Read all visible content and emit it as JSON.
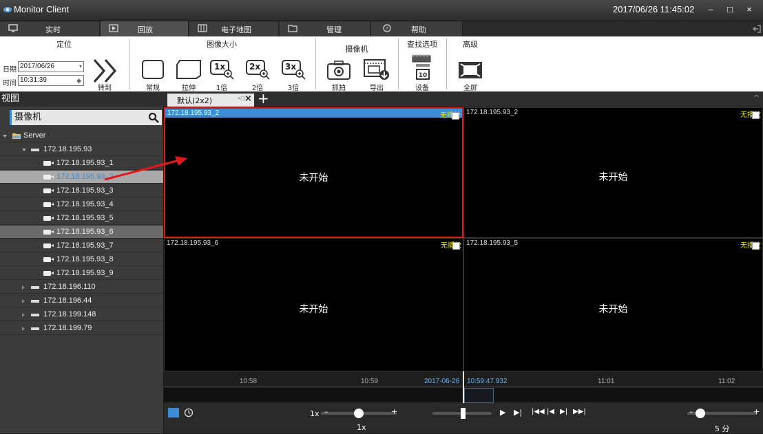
{
  "window": {
    "title": "Monitor Client",
    "clock": "2017/06/26 11:45:02",
    "minimize": "–",
    "maximize": "□",
    "close": "×"
  },
  "menu": {
    "tabs": [
      {
        "label": "实时",
        "icon": "monitor-icon"
      },
      {
        "label": "回放",
        "icon": "play-icon"
      },
      {
        "label": "电子地图",
        "icon": "map-icon"
      },
      {
        "label": "管理",
        "icon": "folder-icon"
      },
      {
        "label": "帮助",
        "icon": "help-icon"
      }
    ]
  },
  "ribbon": {
    "locate": {
      "title": "定位",
      "date_label": "日期",
      "date_value": "2017/06/26",
      "time_label": "时间",
      "time_value": "10:31:39",
      "goto_label": "转到"
    },
    "image_size": {
      "title": "图像大小",
      "buttons": [
        "常规",
        "拉伸",
        "1倍",
        "2倍",
        "3倍"
      ],
      "zoom_texts": [
        "1x",
        "2x",
        "3x"
      ]
    },
    "camera": {
      "title": "摄像机",
      "buttons": [
        "抓拍",
        "导出"
      ]
    },
    "search": {
      "title": "查找选项",
      "buttons": [
        "设备"
      ]
    },
    "advanced": {
      "title": "高级",
      "buttons": [
        "全屏"
      ]
    }
  },
  "left_panel": {
    "header": "视图",
    "search_label": "摄像机",
    "tree": [
      {
        "label": "Server",
        "kind": "server-root"
      },
      {
        "label": "172.18.195.93",
        "kind": "server"
      },
      {
        "label": "172.18.195.93_1",
        "kind": "camera"
      },
      {
        "label": "172.18.195.93_2",
        "kind": "camera"
      },
      {
        "label": "172.18.195.93_3",
        "kind": "camera"
      },
      {
        "label": "172.18.195.93_4",
        "kind": "camera"
      },
      {
        "label": "172.18.195.93_5",
        "kind": "camera"
      },
      {
        "label": "172.18.195.93_6",
        "kind": "camera"
      },
      {
        "label": "172.18.195.93_7",
        "kind": "camera"
      },
      {
        "label": "172.18.195.93_8",
        "kind": "camera"
      },
      {
        "label": "172.18.195.93_9",
        "kind": "camera"
      },
      {
        "label": "172.18.196.110",
        "kind": "server"
      },
      {
        "label": "172.18.196.44",
        "kind": "server"
      },
      {
        "label": "172.18.199.148",
        "kind": "server"
      },
      {
        "label": "172.18.199.79",
        "kind": "server"
      }
    ]
  },
  "view_tab": {
    "label": "默认(2x2)",
    "add": "+"
  },
  "video_cells": [
    {
      "title": "172.18.195.93_2",
      "status": "未开始",
      "tag": "无播放"
    },
    {
      "title": "172.18.195.93_2",
      "status": "未开始",
      "tag": "无播放"
    },
    {
      "title": "172.18.195.93_6",
      "status": "未开始",
      "tag": "无播放"
    },
    {
      "title": "172.18.195.93_5",
      "status": "未开始",
      "tag": "无播放"
    }
  ],
  "timeline": {
    "ticks": [
      "10:58",
      "10:59",
      "11:01",
      "11:02"
    ],
    "cursor_date": "2017-06-26",
    "cursor_time": "10:59:47.932"
  },
  "controls": {
    "speed_label": "1x",
    "speed_value": "1x",
    "zoom_value": "5 分",
    "minus": "–",
    "plus": "+"
  },
  "colors": {
    "accent": "#3c8dd6",
    "selection": "#e0191b",
    "tag": "#e8e800"
  }
}
